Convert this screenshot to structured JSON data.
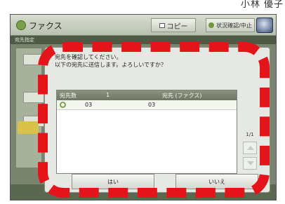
{
  "page": {
    "caption": "小林 優子"
  },
  "header": {
    "title": "ファクス",
    "copy_label": "コピー",
    "status_label": "状況確認/中止",
    "stop_icon": "stop-icon"
  },
  "subheader": {
    "title": "宛先指定"
  },
  "dialog": {
    "line1": "宛先を確認してください。",
    "line2": "以下の宛先に送信します。よろしいですか？",
    "columns": [
      "宛先数",
      "1",
      "宛先 (ファクス)"
    ],
    "rows": [
      {
        "icon": "fax-dest-icon",
        "col1": "03",
        "col2": "03"
      }
    ],
    "pager": "1/1",
    "yes_label": "はい",
    "no_label": "いいえ"
  },
  "colors": {
    "highlight": "#e4141a",
    "header_bar": "#b9c2b0",
    "dialog_bg": "#e6e8e3"
  }
}
